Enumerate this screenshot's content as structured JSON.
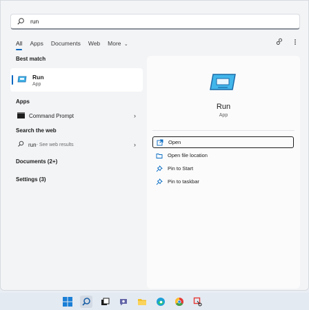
{
  "search": {
    "value": "run"
  },
  "tabs": [
    {
      "label": "All"
    },
    {
      "label": "Apps"
    },
    {
      "label": "Documents"
    },
    {
      "label": "Web"
    },
    {
      "label": "More"
    }
  ],
  "left": {
    "best_match_title": "Best match",
    "best_match": {
      "name": "Run",
      "type": "App"
    },
    "apps_title": "Apps",
    "apps": [
      {
        "label": "Command Prompt"
      }
    ],
    "web_title": "Search the web",
    "web": {
      "query": "run",
      "suffix": " - See web results"
    },
    "documents": "Documents (2+)",
    "settings": "Settings (3)"
  },
  "preview": {
    "title": "Run",
    "type": "App",
    "actions": [
      {
        "label": "Open",
        "icon": "open-icon"
      },
      {
        "label": "Open file location",
        "icon": "folder-icon"
      },
      {
        "label": "Pin to Start",
        "icon": "pin-icon"
      },
      {
        "label": "Pin to taskbar",
        "icon": "pin-icon"
      }
    ]
  },
  "colors": {
    "accent": "#0067c0"
  },
  "taskbar": {
    "icons": [
      "windows-start-icon",
      "search-icon",
      "task-view-icon",
      "teams-chat-icon",
      "file-explorer-icon",
      "edge-icon",
      "chrome-icon",
      "snipping-tool-icon"
    ]
  }
}
